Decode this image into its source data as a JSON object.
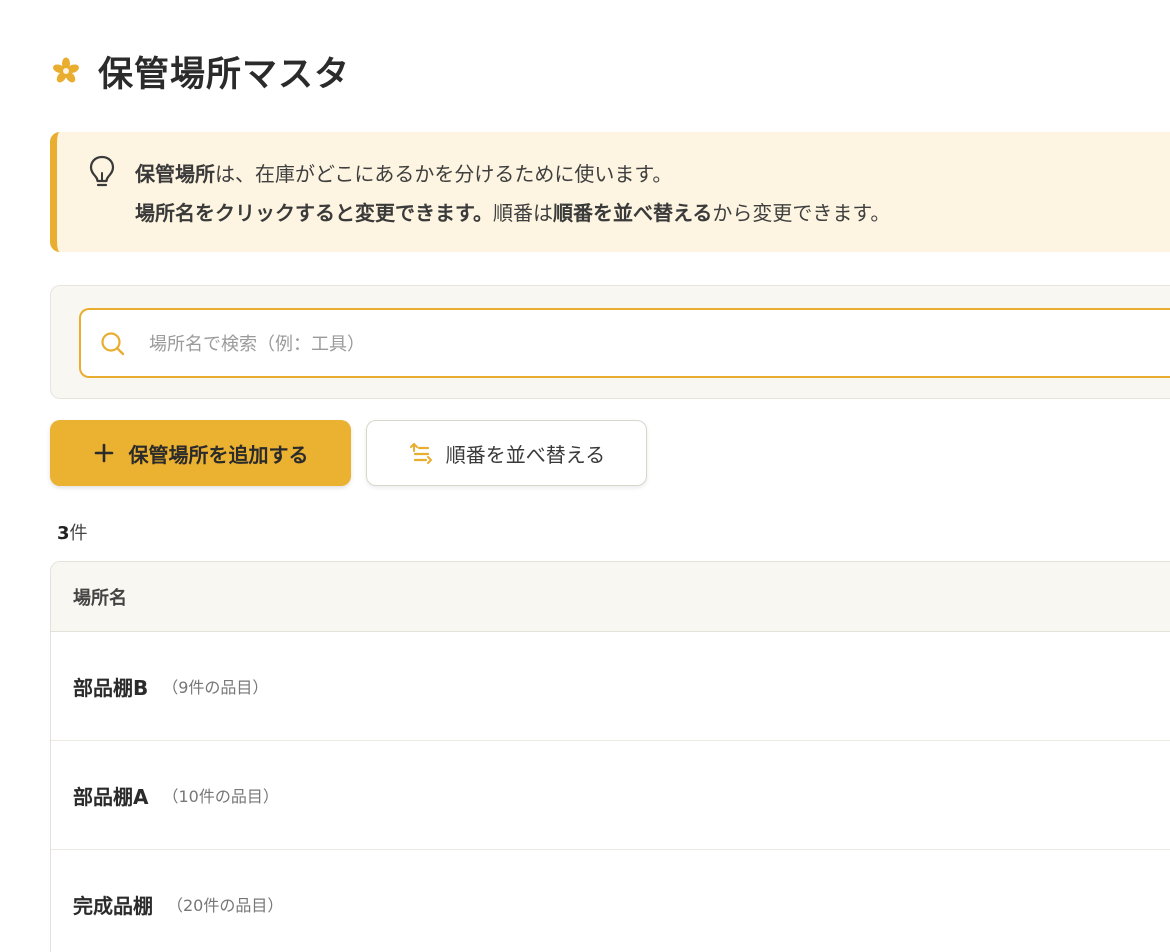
{
  "header": {
    "title": "保管場所マスタ"
  },
  "callout": {
    "line1_bold": "保管場所",
    "line1_rest": "は、在庫がどこにあるかを分けるために使います。",
    "line2_bold1": "場所名をクリックすると変更できます。",
    "line2_mid": "順番は",
    "line2_bold2": "順番を並べ替える",
    "line2_end": "から変更できます。"
  },
  "search": {
    "placeholder": "場所名で検索（例：工具）",
    "value": ""
  },
  "actions": {
    "add_label": "保管場所を追加する",
    "sort_label": "順番を並べ替える"
  },
  "count": {
    "number": "3",
    "unit": "件"
  },
  "table": {
    "column_header": "場所名",
    "rows": [
      {
        "name": "部品棚B",
        "meta": "（9件の品目）"
      },
      {
        "name": "部品棚A",
        "meta": "（10件の品目）"
      },
      {
        "name": "完成品棚",
        "meta": "（20件の品目）"
      }
    ]
  },
  "colors": {
    "accent": "#EBB130",
    "callout_bg": "#FDF5E1",
    "panel_bg": "#F8F7F2"
  },
  "icons": {
    "logo": "flower-icon",
    "hint": "lightbulb-icon",
    "search": "search-icon",
    "add": "plus-icon",
    "sort": "sort-list-icon"
  }
}
